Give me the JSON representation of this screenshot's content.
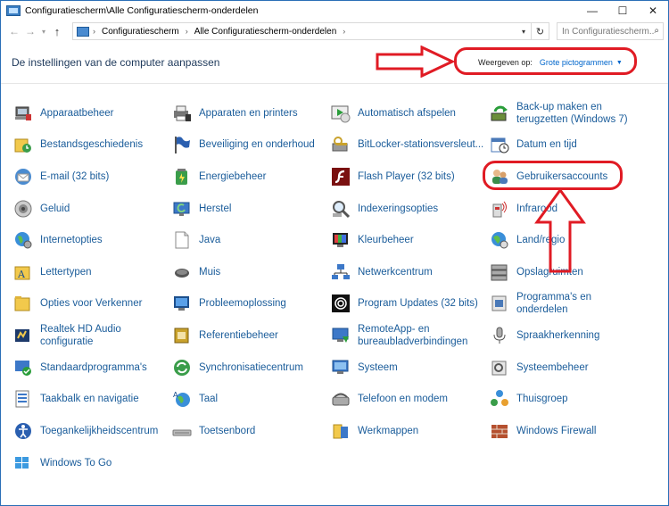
{
  "window": {
    "title": "Configuratiescherm\\Alle Configuratiescherm-onderdelen",
    "controls": {
      "minimize": "—",
      "maximize": "☐",
      "close": "✕"
    }
  },
  "address": {
    "crumbs": [
      "Configuratiescherm",
      "Alle Configuratiescherm-onderdelen"
    ],
    "search_placeholder": "In Configuratiescherm..."
  },
  "header": {
    "title": "De instellingen van de computer aanpassen",
    "view_by_label": "Weergeven op:",
    "view_by_value": "Grote pictogrammen"
  },
  "items": [
    {
      "label": "Apparaatbeheer",
      "icon": "device-manager-icon"
    },
    {
      "label": "Apparaten en printers",
      "icon": "devices-printers-icon"
    },
    {
      "label": "Automatisch afspelen",
      "icon": "autoplay-icon"
    },
    {
      "label": "Back-up maken en terugzetten (Windows 7)",
      "line1": "Back-up maken en",
      "line2": "terugzetten (Windows 7)",
      "icon": "backup-icon"
    },
    {
      "label": "Bestandsgeschiedenis",
      "icon": "file-history-icon"
    },
    {
      "label": "Beveiliging en onderhoud",
      "icon": "security-flag-icon"
    },
    {
      "label": "BitLocker-stationsversleut...",
      "icon": "bitlocker-icon"
    },
    {
      "label": "Datum en tijd",
      "icon": "date-time-icon"
    },
    {
      "label": "E-mail (32 bits)",
      "icon": "email-icon"
    },
    {
      "label": "Energiebeheer",
      "icon": "power-options-icon"
    },
    {
      "label": "Flash Player (32 bits)",
      "icon": "flash-player-icon"
    },
    {
      "label": "Gebruikersaccounts",
      "icon": "user-accounts-icon"
    },
    {
      "label": "Geluid",
      "icon": "sound-icon"
    },
    {
      "label": "Herstel",
      "icon": "recovery-icon"
    },
    {
      "label": "Indexeringsopties",
      "icon": "indexing-icon"
    },
    {
      "label": "Infrarood",
      "icon": "infrared-icon"
    },
    {
      "label": "Internetopties",
      "icon": "internet-options-icon"
    },
    {
      "label": "Java",
      "icon": "java-icon"
    },
    {
      "label": "Kleurbeheer",
      "icon": "color-management-icon"
    },
    {
      "label": "Land/regio",
      "icon": "region-icon"
    },
    {
      "label": "Lettertypen",
      "icon": "fonts-icon"
    },
    {
      "label": "Muis",
      "icon": "mouse-icon"
    },
    {
      "label": "Netwerkcentrum",
      "icon": "network-center-icon"
    },
    {
      "label": "Opslagruimten",
      "icon": "storage-spaces-icon"
    },
    {
      "label": "Opties voor Verkenner",
      "icon": "explorer-options-icon"
    },
    {
      "label": "Probleemoplossing",
      "icon": "troubleshooting-icon"
    },
    {
      "label": "Program Updates (32 bits)",
      "icon": "program-updates-icon"
    },
    {
      "label": "Programma's en onderdelen",
      "line1": "Programma's en",
      "line2": "onderdelen",
      "icon": "programs-features-icon"
    },
    {
      "label": "Realtek HD Audio configuratie",
      "line1": "Realtek HD Audio",
      "line2": "configuratie",
      "icon": "realtek-audio-icon"
    },
    {
      "label": "Referentiebeheer",
      "icon": "credential-manager-icon"
    },
    {
      "label": "RemoteApp- en bureaubladverbindingen",
      "line1": "RemoteApp- en",
      "line2": "bureaubladverbindingen",
      "icon": "remoteapp-icon"
    },
    {
      "label": "Spraakherkenning",
      "icon": "speech-recognition-icon"
    },
    {
      "label": "Standaardprogramma's",
      "icon": "default-programs-icon"
    },
    {
      "label": "Synchronisatiecentrum",
      "icon": "sync-center-icon"
    },
    {
      "label": "Systeem",
      "icon": "system-icon"
    },
    {
      "label": "Systeembeheer",
      "icon": "administrative-tools-icon"
    },
    {
      "label": "Taakbalk en navigatie",
      "icon": "taskbar-icon"
    },
    {
      "label": "Taal",
      "icon": "language-icon"
    },
    {
      "label": "Telefoon en modem",
      "icon": "phone-modem-icon"
    },
    {
      "label": "Thuisgroep",
      "icon": "homegroup-icon"
    },
    {
      "label": "Toegankelijkheidscentrum",
      "icon": "ease-of-access-icon"
    },
    {
      "label": "Toetsenbord",
      "icon": "keyboard-icon"
    },
    {
      "label": "Werkmappen",
      "icon": "work-folders-icon"
    },
    {
      "label": "Windows Firewall",
      "icon": "windows-firewall-icon"
    },
    {
      "label": "Windows To Go",
      "icon": "windows-to-go-icon"
    }
  ],
  "colors": {
    "link": "#1a5c9a",
    "header": "#1e395b",
    "annotation": "#e01b24",
    "window_border": "#2b6fb7"
  }
}
